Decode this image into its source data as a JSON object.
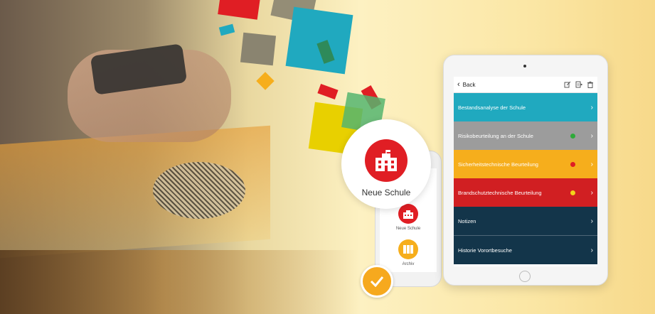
{
  "colors": {
    "red": "#e01e24",
    "teal": "#20a9bf",
    "gray": "#9c9c9c",
    "orange": "#f6ae1c",
    "crimson": "#d11f22",
    "navy": "#13354a",
    "yellow": "#e8d000",
    "olive": "#847b66"
  },
  "bubble": {
    "label": "Neue Schule",
    "icon": "school-building-icon"
  },
  "iphone": {
    "items": [
      {
        "label": "Neue Schule",
        "icon": "school-building-icon"
      },
      {
        "label": "Archiv",
        "icon": "archive-binders-icon"
      }
    ]
  },
  "check": {
    "icon": "checkmark-icon"
  },
  "ipad": {
    "nav": {
      "back_label": "Back",
      "actions": [
        "edit-icon",
        "document-export-icon",
        "trash-icon"
      ]
    },
    "rows": [
      {
        "label": "Bestandsanalyse der Schule",
        "color": "#20a9bf",
        "status": ""
      },
      {
        "label": "Risikobeurteilung an der Schule",
        "color": "#9c9c9c",
        "status": "green"
      },
      {
        "label": "Sicherheitstechnische Beurteilung",
        "color": "#f6ae1c",
        "status": "red"
      },
      {
        "label": "Brandschutztechnische Beurteilung",
        "color": "#d11f22",
        "status": "yellow"
      },
      {
        "label": "Notizen",
        "color": "#13354a",
        "status": ""
      },
      {
        "label": "Historie Vorortbesuche",
        "color": "#13354a",
        "status": ""
      }
    ]
  }
}
